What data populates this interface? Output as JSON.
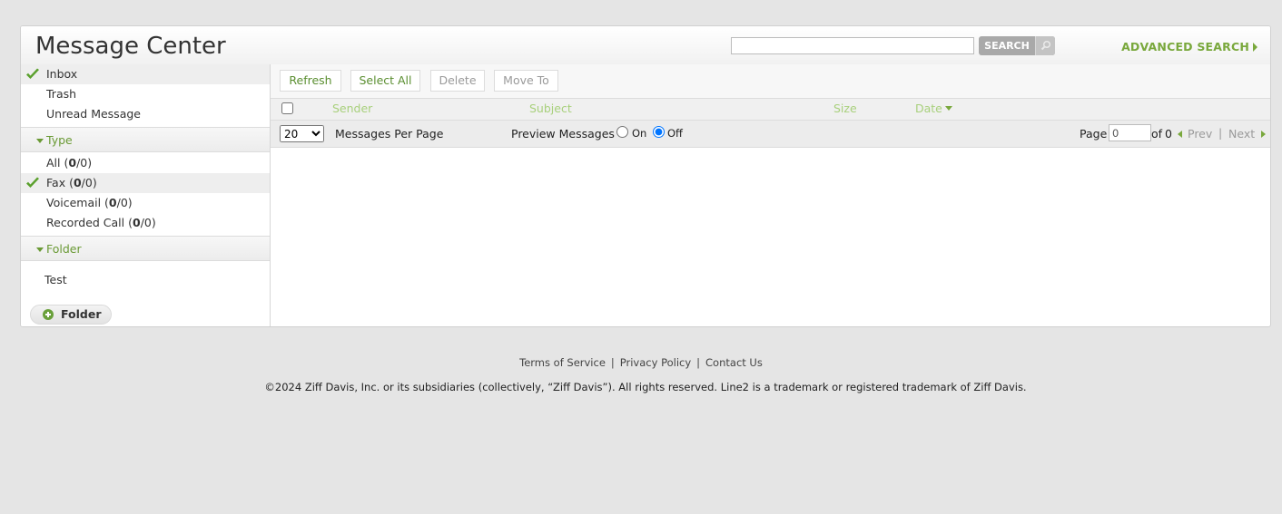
{
  "header": {
    "title": "Message Center",
    "search_placeholder": "",
    "search_button": "SEARCH",
    "advanced_search": "ADVANCED SEARCH"
  },
  "sidebar": {
    "mailboxes": [
      {
        "label": "Inbox",
        "active": true
      },
      {
        "label": "Trash",
        "active": false
      },
      {
        "label": "Unread Message",
        "active": false
      }
    ],
    "type_header": "Type",
    "types": [
      {
        "name": "All",
        "unread": "0",
        "total": "0",
        "active": false
      },
      {
        "name": "Fax",
        "unread": "0",
        "total": "0",
        "active": true
      },
      {
        "name": "Voicemail",
        "unread": "0",
        "total": "0",
        "active": false
      },
      {
        "name": "Recorded Call",
        "unread": "0",
        "total": "0",
        "active": false
      }
    ],
    "folder_header": "Folder",
    "folders": [
      {
        "label": "Test"
      }
    ],
    "add_folder": "Folder"
  },
  "toolbar": {
    "refresh": "Refresh",
    "select_all": "Select All",
    "delete": "Delete",
    "move_to": "Move To"
  },
  "columns": {
    "sender": "Sender",
    "subject": "Subject",
    "size": "Size",
    "date": "Date"
  },
  "options": {
    "per_page_value": "20",
    "per_page_options": [
      "20"
    ],
    "per_page_label": "Messages Per Page",
    "preview_label": "Preview Messages",
    "preview_on": "On",
    "preview_off": "Off",
    "preview_selected": "Off",
    "page_label": "Page",
    "page_value": "0",
    "of_label": "of",
    "total_pages": "0",
    "prev": "Prev",
    "next": "Next"
  },
  "footer": {
    "links": [
      "Terms of Service",
      "Privacy Policy",
      "Contact Us"
    ],
    "copyright": "©2024 Ziff Davis, Inc. or its subsidiaries (collectively, “Ziff Davis”). All rights reserved. Line2 is a trademark or registered trademark of Ziff Davis."
  },
  "colors": {
    "accent_green": "#79a83c",
    "column_header_green": "#a8d07c",
    "check_green": "#5aa02c"
  }
}
